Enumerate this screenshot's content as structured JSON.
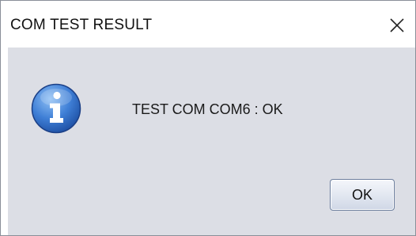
{
  "window": {
    "title": "COM TEST RESULT",
    "close_icon": "close-icon"
  },
  "dialog": {
    "icon": "info-icon",
    "message": "TEST COM COM6 : OK",
    "ok_label": "OK"
  },
  "colors": {
    "title_bar": "#ffffff",
    "content_background": "#dcdee5",
    "icon_blue": "#2f6fc7",
    "button_border": "#6d7f9e"
  }
}
